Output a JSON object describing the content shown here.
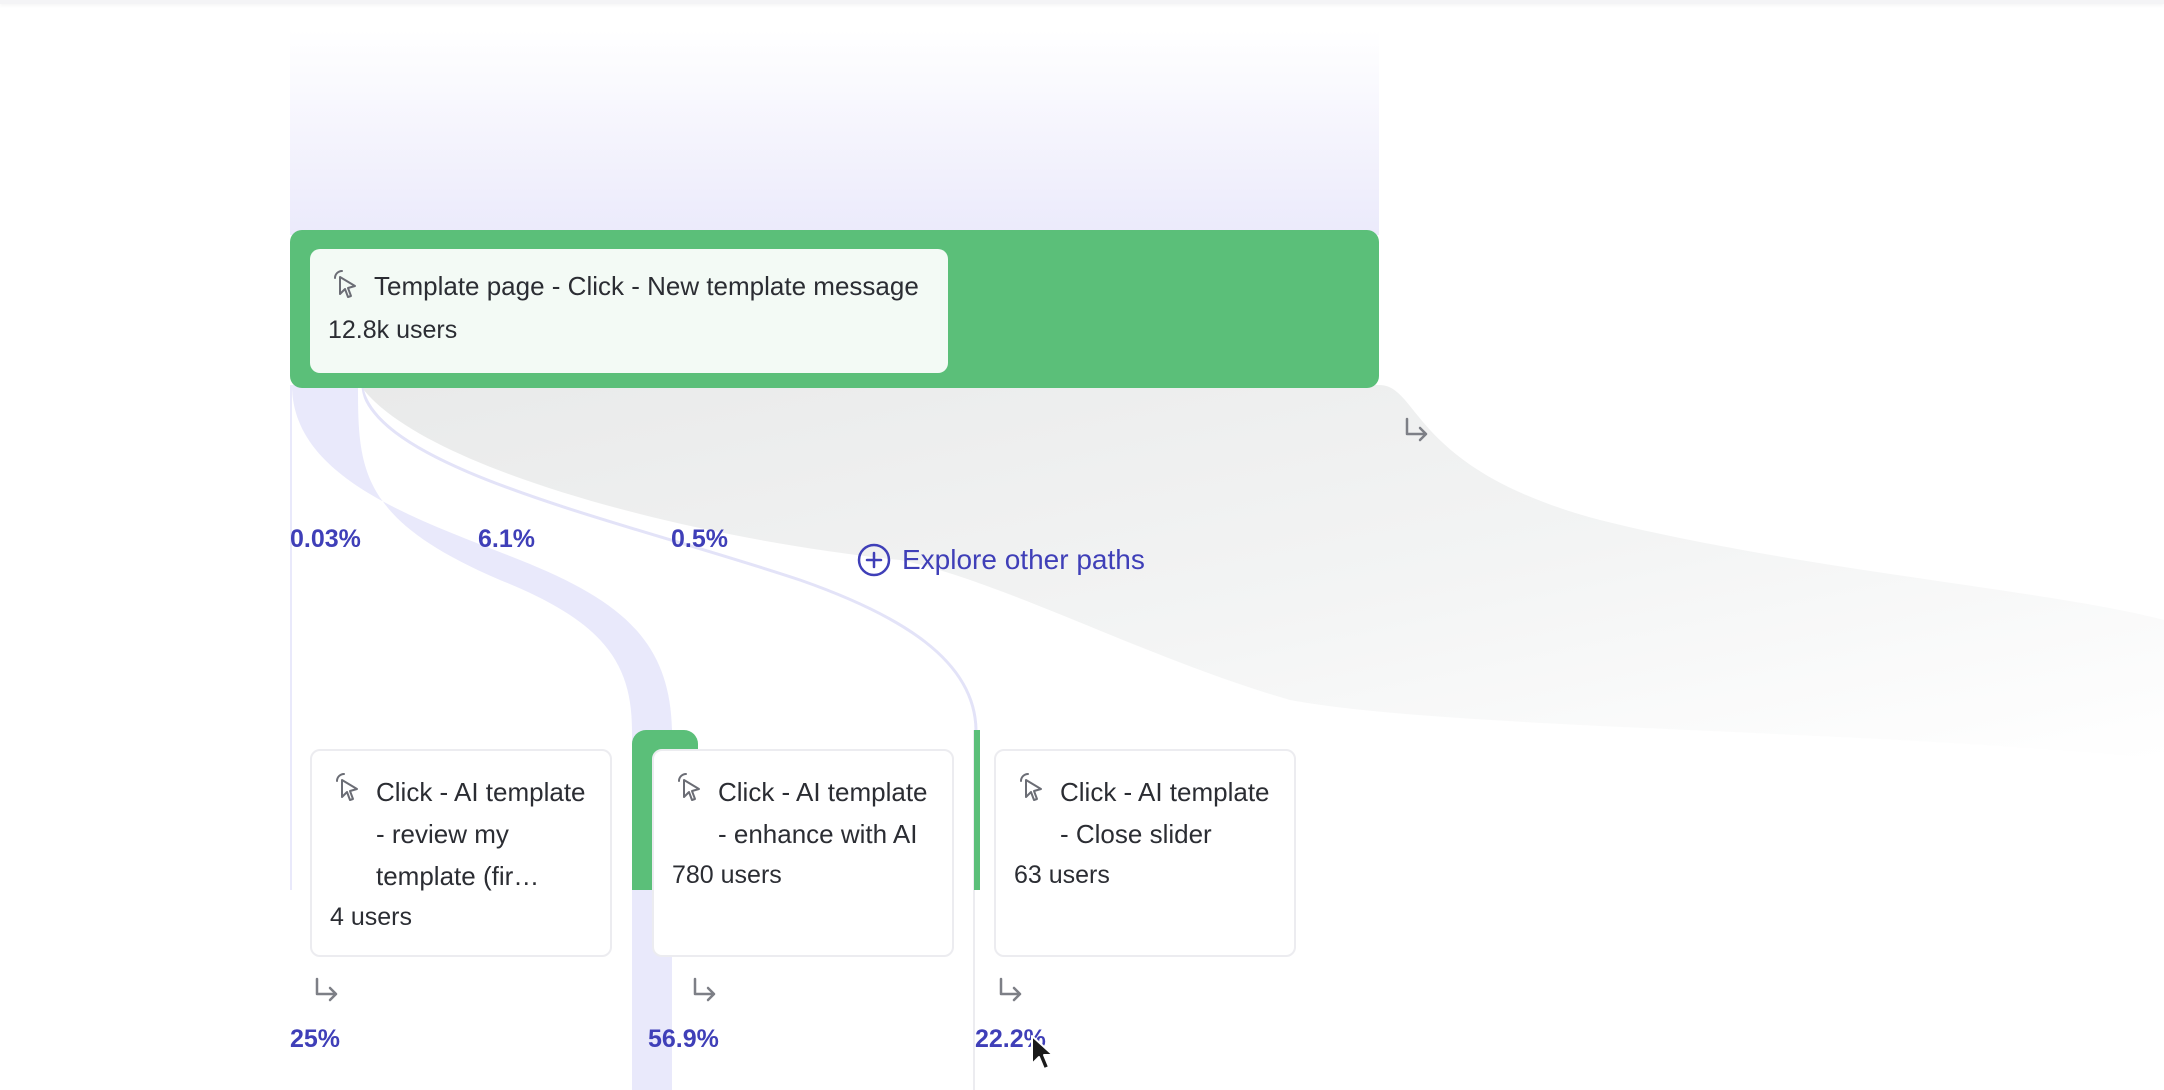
{
  "root_node": {
    "title": "Template page - Click - New template message",
    "users": "12.8k users",
    "icon": "cursor-click-icon"
  },
  "branch_percentages": [
    "0.03%",
    "6.1%",
    "0.5%"
  ],
  "explore_label": "Explore other paths",
  "child_nodes": [
    {
      "title": "Click - AI template - review my template (fir…",
      "users": "4 users",
      "icon": "cursor-click-icon",
      "continue_pct": "25%"
    },
    {
      "title": "Click - AI template - enhance with AI",
      "users": "780 users",
      "icon": "cursor-click-icon",
      "continue_pct": "56.9%"
    },
    {
      "title": "Click - AI template - Close slider",
      "users": "63 users",
      "icon": "cursor-click-icon",
      "continue_pct": "22.2%"
    }
  ],
  "colors": {
    "node_green": "#5bbf79",
    "accent_blue": "#3f3fb8",
    "flow_lavender": "#e9e9fb",
    "dropoff_gray": "#f0f1f1"
  }
}
